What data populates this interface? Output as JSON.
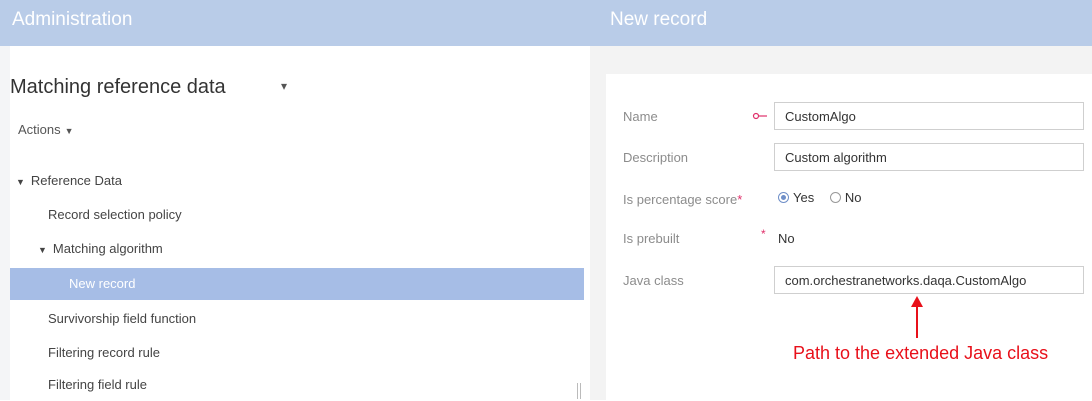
{
  "header": {
    "left_title": "Administration",
    "right_title": "New record"
  },
  "sidebar": {
    "title": "Matching reference data",
    "actions_label": "Actions",
    "tree": [
      {
        "label": "Reference Data",
        "expanded": true
      },
      {
        "label": "Record selection policy"
      },
      {
        "label": "Matching algorithm",
        "expanded": true
      },
      {
        "label": "New record",
        "selected": true
      },
      {
        "label": "Survivorship field function"
      },
      {
        "label": "Filtering record rule"
      },
      {
        "label": "Filtering field rule"
      }
    ]
  },
  "form": {
    "name_label": "Name",
    "name_value": "CustomAlgo",
    "description_label": "Description",
    "description_value": "Custom algorithm",
    "percentage_label": "Is percentage score",
    "required_star": "*",
    "option_yes": "Yes",
    "option_no": "No",
    "percentage_selected": "Yes",
    "prebuilt_label": "Is prebuilt",
    "prebuilt_value": "No",
    "java_class_label": "Java class",
    "java_class_value": "com.orchestranetworks.daqa.CustomAlgo"
  },
  "annotation": {
    "text": "Path to the extended Java class",
    "color": "#e8101a"
  },
  "colors": {
    "header_bg": "#b9cce8",
    "selected_row": "#a6bde6",
    "required": "#e0306a"
  },
  "icons": {
    "title_caret": "caret-down-icon",
    "actions_caret": "caret-down-icon",
    "tree_toggle": "triangle-down-icon",
    "name_pointer": "pointer-icon",
    "arrow": "arrow-up-icon"
  }
}
